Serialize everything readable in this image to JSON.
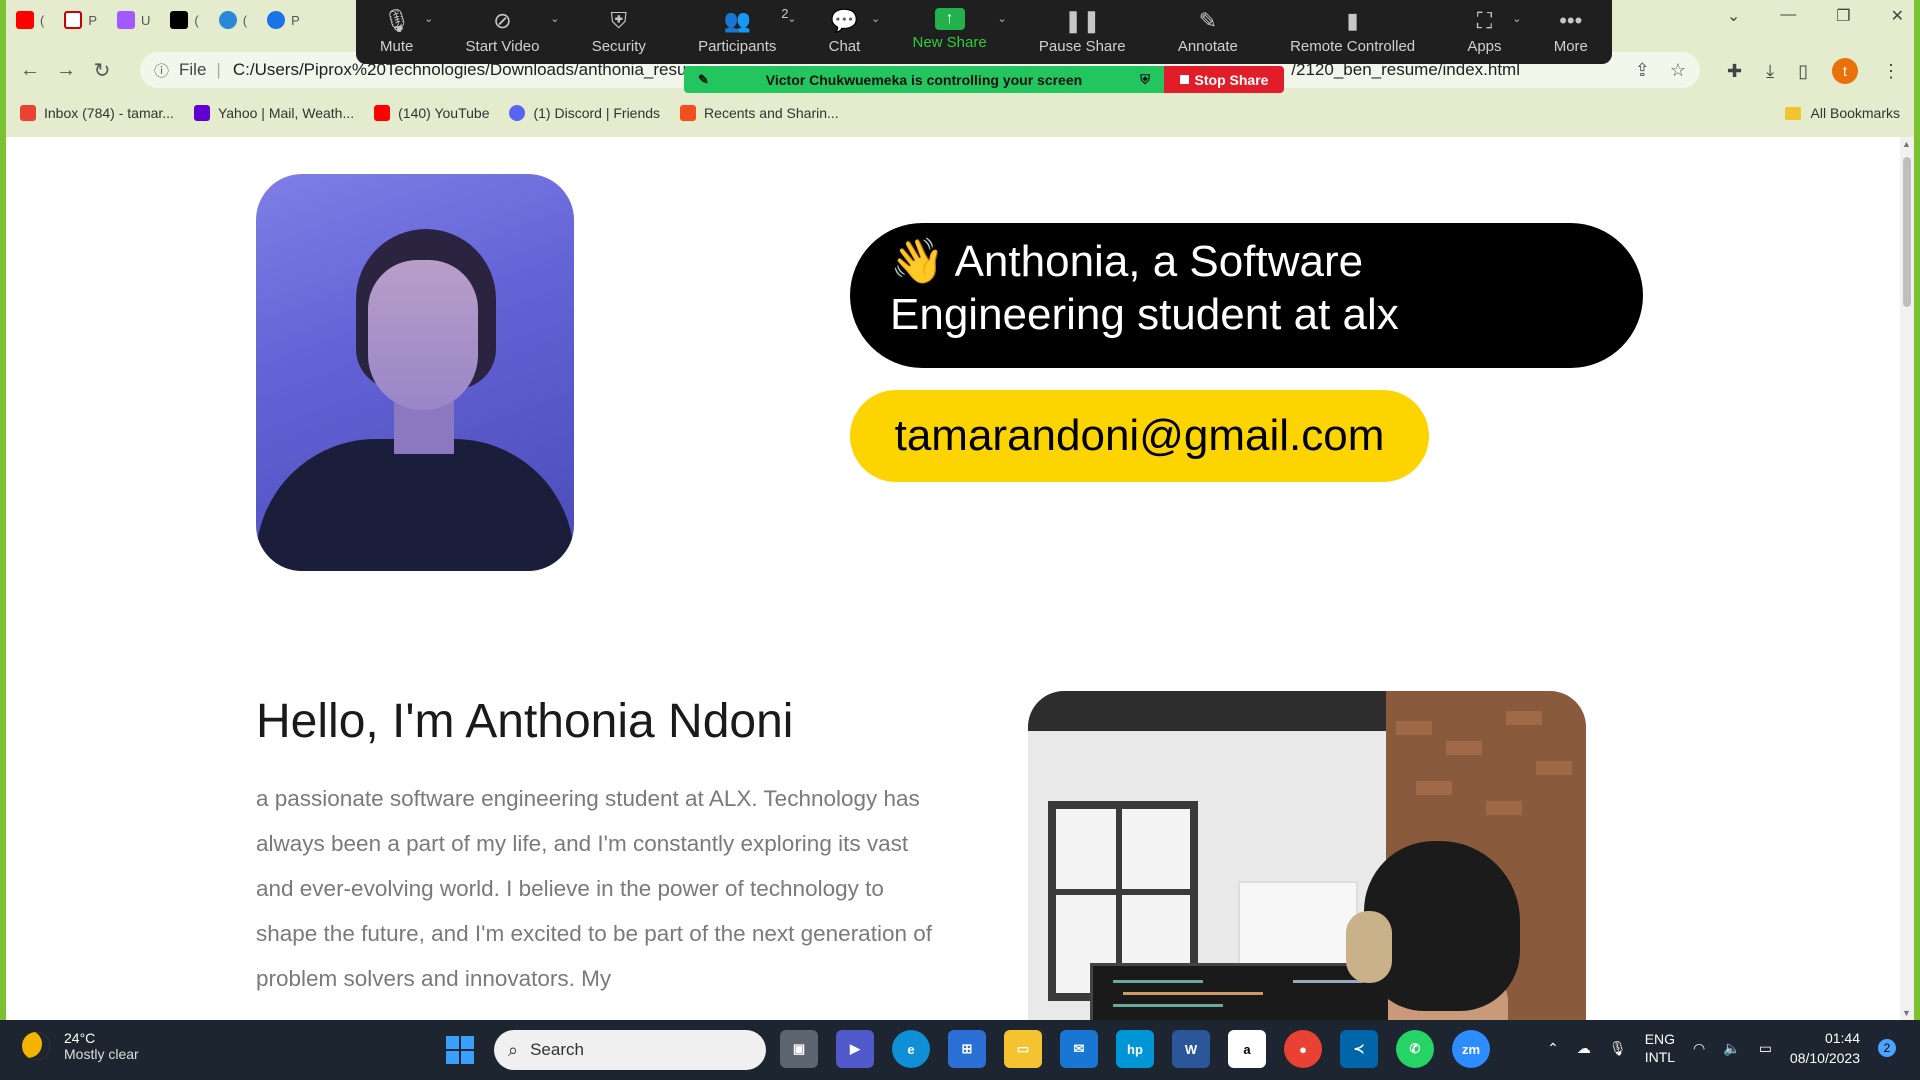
{
  "browser": {
    "tabs": [
      {
        "label": "(",
        "color": "#ff0000",
        "icon": "youtube-icon"
      },
      {
        "label": "P",
        "color": "#ffffff",
        "icon": "document-icon"
      },
      {
        "label": "U",
        "color": "#a259ff",
        "icon": "figma-icon"
      },
      {
        "label": "(",
        "color": "#000000",
        "icon": "x-icon"
      },
      {
        "label": "(",
        "color": "#2b88d8",
        "icon": "discord-icon"
      },
      {
        "label": "P",
        "color": "#1a73e8",
        "icon": "zoom-icon"
      }
    ],
    "address": {
      "scheme_label": "File",
      "url": "C:/Users/Piprox%20Technologies/Downloads/anthonia_resu",
      "url_tail": "/2120_ben_resume/index.html"
    },
    "bookmarks": [
      {
        "label": "Inbox (784) - tamar...",
        "color": "#ea4335",
        "icon": "gmail-icon"
      },
      {
        "label": "Yahoo | Mail, Weath...",
        "color": "#6001d2",
        "icon": "yahoo-icon"
      },
      {
        "label": "(140) YouTube",
        "color": "#ff0000",
        "icon": "youtube-icon"
      },
      {
        "label": "(1) Discord | Friends",
        "color": "#5865f2",
        "icon": "discord-icon"
      },
      {
        "label": "Recents and Sharin...",
        "color": "#f24e1e",
        "icon": "figma-icon"
      }
    ],
    "all_bookmarks": "All Bookmarks",
    "profile_initial": "t"
  },
  "zoom": {
    "buttons": {
      "mute": "Mute",
      "start_video": "Start Video",
      "security": "Security",
      "participants": "Participants",
      "participants_count": "2",
      "chat": "Chat",
      "new_share": "New Share",
      "pause_share": "Pause Share",
      "annotate": "Annotate",
      "remote_controlled": "Remote Controlled",
      "apps": "Apps",
      "more": "More"
    },
    "banner": "Victor Chukwuemeka is controlling your screen",
    "stop_share": "Stop Share"
  },
  "page": {
    "hero_line1": "👋 Anthonia, a Software",
    "hero_line2": "Engineering student at alx",
    "email": "tamarandoni@gmail.com",
    "hello": "Hello, I'm Anthonia Ndoni",
    "bio": "a passionate software engineering student at ALX. Technology has always been a part of my life, and I'm constantly exploring its vast and ever-evolving world. I believe in the power of technology to shape the future, and I'm excited to be part of the next generation of problem solvers and innovators. My"
  },
  "taskbar": {
    "temperature": "24°C",
    "weather": "Mostly clear",
    "search": "Search",
    "lang_1": "ENG",
    "lang_2": "INTL",
    "time": "01:44",
    "date": "08/10/2023",
    "notifications": "2"
  }
}
